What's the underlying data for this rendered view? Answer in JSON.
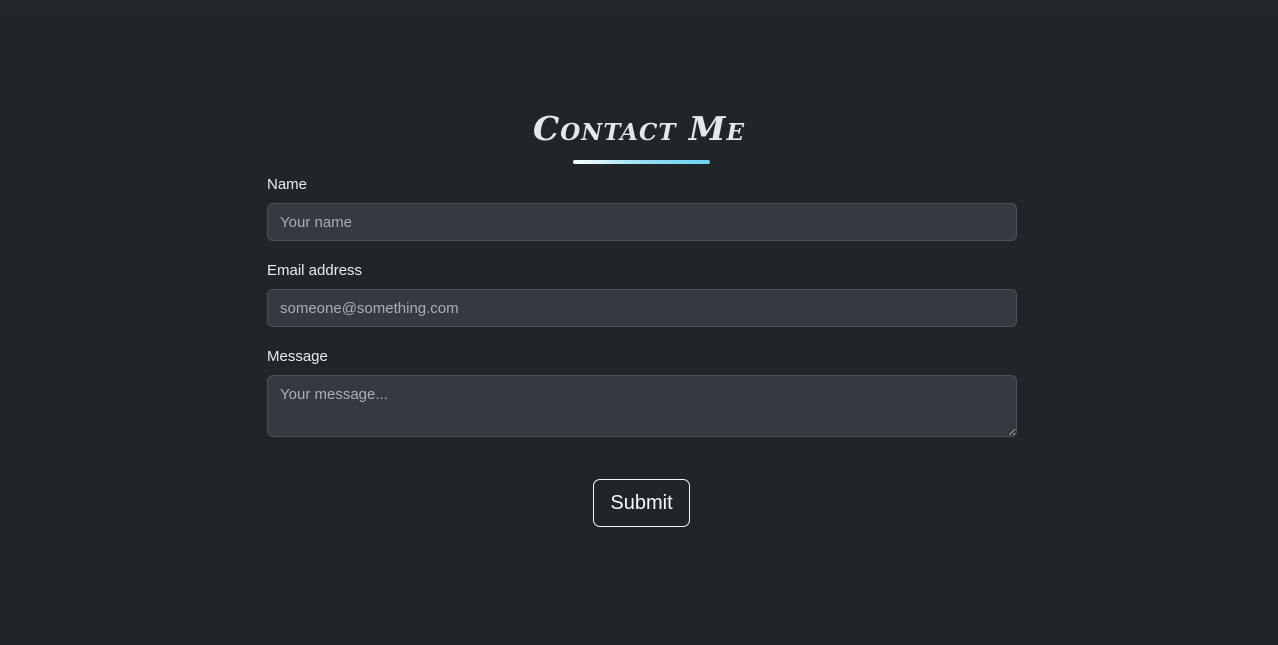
{
  "contact": {
    "heading": "Contact Me",
    "fields": {
      "name": {
        "label": "Name",
        "placeholder": "Your name"
      },
      "email": {
        "label": "Email address",
        "placeholder": "someone@something.com"
      },
      "message": {
        "label": "Message",
        "placeholder": "Your message..."
      }
    },
    "submit_label": "Submit"
  },
  "colors": {
    "background": "#212529",
    "input_background": "#343a40",
    "accent": "#6cd3f2",
    "text": "#e9ecef"
  }
}
